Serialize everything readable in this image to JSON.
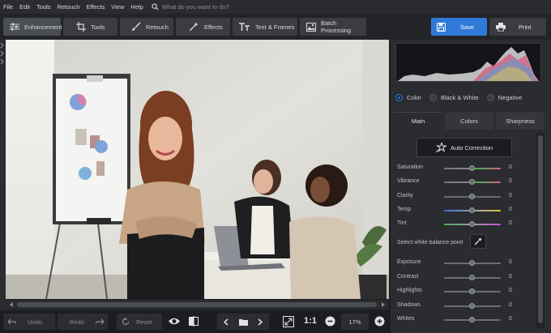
{
  "menu": [
    "File",
    "Edit",
    "Tools",
    "Retouch",
    "Effects",
    "View",
    "Help"
  ],
  "search": {
    "placeholder": "What do you want to do?"
  },
  "toolbar": {
    "tabs": [
      {
        "label": "Enhancement",
        "icon": "sliders-icon"
      },
      {
        "label": "Tools",
        "icon": "crop-icon"
      },
      {
        "label": "Retouch",
        "icon": "brush-icon"
      },
      {
        "label": "Effects",
        "icon": "sparkle-icon"
      },
      {
        "label": "Text & Frames",
        "icon": "text-icon"
      },
      {
        "label": "Batch Processing",
        "icon": "images-icon"
      }
    ],
    "save_label": "Save",
    "print_label": "Print"
  },
  "bottombar": {
    "undo": "Undo",
    "redo": "Redo",
    "reset": "Reset",
    "zoom_ratio": "1:1",
    "zoom_level": "17%"
  },
  "panel": {
    "modes": [
      {
        "label": "Color",
        "selected": true
      },
      {
        "label": "Black & White",
        "selected": false
      },
      {
        "label": "Negative",
        "selected": false
      }
    ],
    "tabs": [
      "Main",
      "Colors",
      "Sharpness"
    ],
    "auto_correction": "Auto Correction",
    "white_balance_label": "Select white balance point",
    "sliders_top": [
      {
        "label": "Saturation",
        "value": "0",
        "track": "sat"
      },
      {
        "label": "Vibrance",
        "value": "0",
        "track": "sat"
      },
      {
        "label": "Clarity",
        "value": "0",
        "track": "gray"
      },
      {
        "label": "Temp",
        "value": "0",
        "track": "temp"
      },
      {
        "label": "Tint",
        "value": "0",
        "track": "tint"
      }
    ],
    "sliders_bottom": [
      {
        "label": "Exposure",
        "value": "0"
      },
      {
        "label": "Contrast",
        "value": "0"
      },
      {
        "label": "Highlights",
        "value": "0"
      },
      {
        "label": "Shadows",
        "value": "0"
      },
      {
        "label": "Whites",
        "value": "0"
      }
    ]
  },
  "colors": {
    "accent": "#2f7ad8",
    "panel_bg": "#2a2c30"
  }
}
